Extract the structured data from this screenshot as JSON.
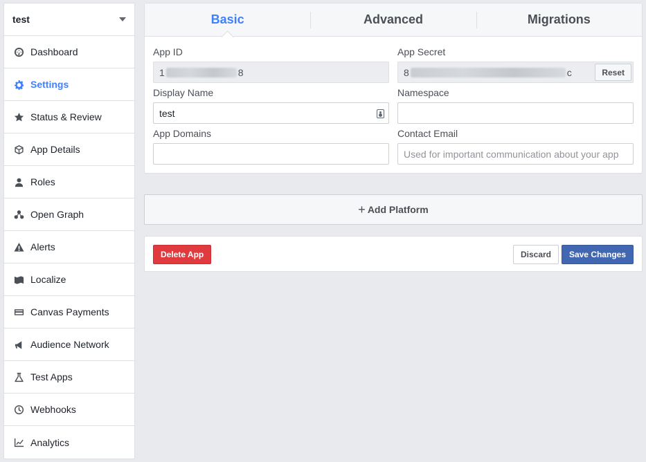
{
  "app_selector": {
    "name": "test"
  },
  "sidebar": {
    "items": [
      {
        "label": "Dashboard",
        "icon": "dashboard-icon"
      },
      {
        "label": "Settings",
        "icon": "gear-icon",
        "active": true
      },
      {
        "label": "Status & Review",
        "icon": "star-icon"
      },
      {
        "label": "App Details",
        "icon": "cube-icon"
      },
      {
        "label": "Roles",
        "icon": "person-icon"
      },
      {
        "label": "Open Graph",
        "icon": "graph-icon"
      },
      {
        "label": "Alerts",
        "icon": "warning-icon"
      },
      {
        "label": "Localize",
        "icon": "map-icon"
      },
      {
        "label": "Canvas Payments",
        "icon": "credit-card-icon"
      },
      {
        "label": "Audience Network",
        "icon": "megaphone-icon"
      },
      {
        "label": "Test Apps",
        "icon": "flask-icon"
      },
      {
        "label": "Webhooks",
        "icon": "clock-icon"
      },
      {
        "label": "Analytics",
        "icon": "chart-icon"
      }
    ]
  },
  "tabs": [
    {
      "label": "Basic",
      "active": true
    },
    {
      "label": "Advanced"
    },
    {
      "label": "Migrations"
    }
  ],
  "form": {
    "app_id": {
      "label": "App ID",
      "value_start": "1",
      "value_end": "8"
    },
    "app_secret": {
      "label": "App Secret",
      "value_start": "8",
      "value_end": "c",
      "reset_label": "Reset"
    },
    "display_name": {
      "label": "Display Name",
      "value": "test"
    },
    "namespace": {
      "label": "Namespace",
      "value": ""
    },
    "app_domains": {
      "label": "App Domains",
      "value": ""
    },
    "contact_email": {
      "label": "Contact Email",
      "placeholder": "Used for important communication about your app"
    }
  },
  "add_platform": {
    "plus": "+",
    "label": "Add Platform"
  },
  "actions": {
    "delete_label": "Delete App",
    "discard_label": "Discard",
    "save_label": "Save Changes"
  },
  "colors": {
    "accent": "#4080ff",
    "delete": "#e03a3e",
    "save": "#4267b2",
    "background": "#e9eaed"
  }
}
